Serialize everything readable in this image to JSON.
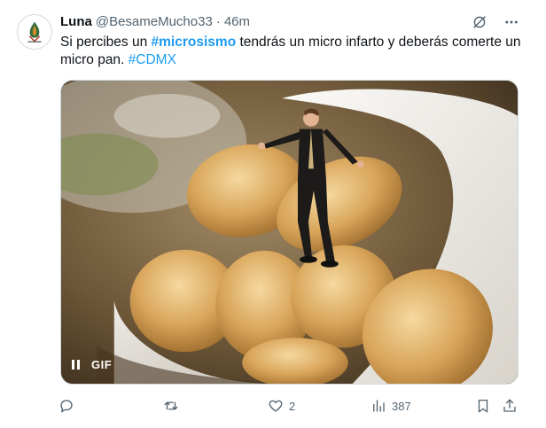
{
  "tweet": {
    "author_name": "Luna",
    "author_handle": "@BesameMucho33",
    "separator": "·",
    "time": "46m",
    "text_before": "Si percibes un ",
    "hashtag_bold": "#microsismo",
    "text_after": " tendrás un micro infarto y deberás comerte un micro pan. ",
    "hashtag": "#CDMX"
  },
  "media": {
    "gif_label": "GIF",
    "state": "playing"
  },
  "actions": {
    "replies": "",
    "retweets": "",
    "likes": "2",
    "views": "387"
  },
  "icons": {
    "header": [
      "grok-icon",
      "more-icon"
    ],
    "actions": [
      "reply-icon",
      "retweet-icon",
      "like-icon",
      "views-icon",
      "bookmark-icon",
      "share-icon"
    ]
  },
  "colors": {
    "accent": "#1d9bf0",
    "muted": "#536471",
    "text": "#0f1419"
  }
}
